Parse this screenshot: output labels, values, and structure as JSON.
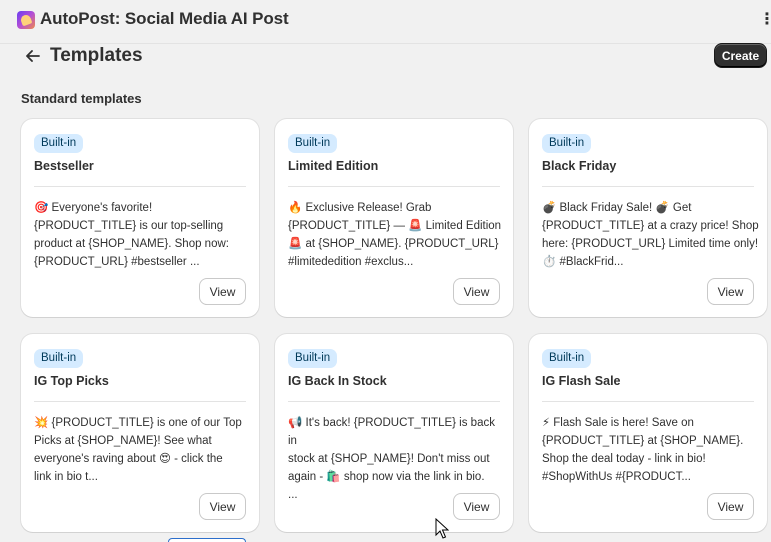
{
  "app": {
    "title": "AutoPost: Social Media AI Post",
    "icon": "autopost-app-icon"
  },
  "header": {
    "title": "Templates",
    "back_icon": "arrow-left-icon",
    "create_label": "Create",
    "more_icon": "more-vertical-icon"
  },
  "section": {
    "title": "Standard templates"
  },
  "view_label": "View",
  "cards": [
    {
      "badge": "Built-in",
      "title": "Bestseller",
      "body": "🎯 Everyone's favorite!\n{PRODUCT_TITLE} is our top-selling\nproduct at {SHOP_NAME}. Shop now:\n{PRODUCT_URL} #bestseller ..."
    },
    {
      "badge": "Built-in",
      "title": "Limited Edition",
      "body": "🔥 Exclusive Release! Grab\n{PRODUCT_TITLE} — 🚨 Limited Edition\n🚨 at {SHOP_NAME}. {PRODUCT_URL}\n#limitededition #exclus..."
    },
    {
      "badge": "Built-in",
      "title": "Black Friday",
      "body": "💣 Black Friday Sale! 💣 Get\n{PRODUCT_TITLE} at a crazy price! Shop\nhere: {PRODUCT_URL} Limited time only!\n⏱️ #BlackFrid..."
    },
    {
      "badge": "Built-in",
      "title": "IG Top Picks",
      "body": "💥 {PRODUCT_TITLE} is one of our Top\nPicks at {SHOP_NAME}! See what\neveryone's raving about 😍 - click the\nlink in bio t..."
    },
    {
      "badge": "Built-in",
      "title": "IG Back In Stock",
      "body": "📢 It's back! {PRODUCT_TITLE} is back in\nstock at {SHOP_NAME}! Don't miss out\nagain - 🛍️ shop now via the link in bio.\n..."
    },
    {
      "badge": "Built-in",
      "title": "IG Flash Sale",
      "body": "⚡ Flash Sale is here! Save on\n{PRODUCT_TITLE} at {SHOP_NAME}.\nShop the deal today - link in bio!\n#ShopWithUs #{PRODUCT..."
    }
  ]
}
